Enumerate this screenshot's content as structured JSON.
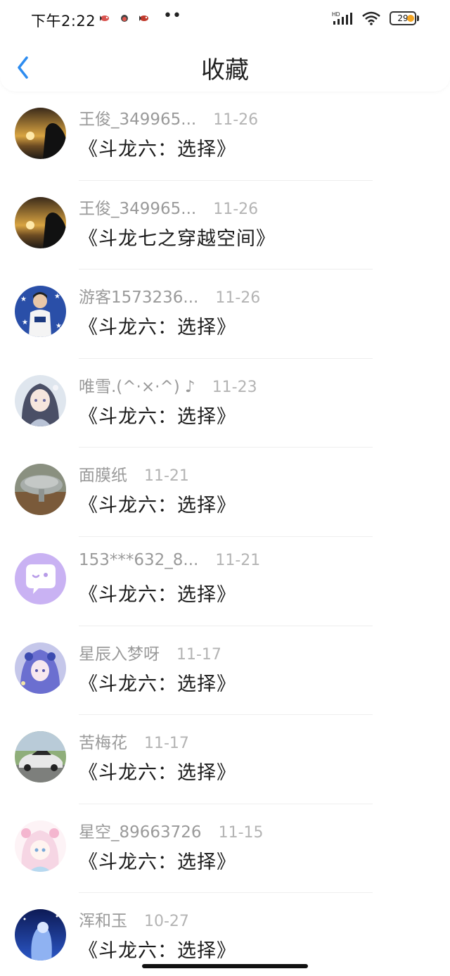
{
  "status_bar": {
    "time": "下午2:22",
    "more": "••",
    "network": "HD",
    "battery": "29",
    "colors": {
      "battery_charge": "#f5a623"
    }
  },
  "nav": {
    "title": "收藏",
    "back_icon": "chevron-left-icon",
    "accent": "#2d8cf0"
  },
  "items": [
    {
      "username": "王俊_349965...",
      "date": "11-26",
      "title": "《斗龙六：选择》",
      "avatar": "sunset-person"
    },
    {
      "username": "王俊_349965...",
      "date": "11-26",
      "title": "《斗龙七之穿越空间》",
      "avatar": "sunset-person"
    },
    {
      "username": "游客1573236...",
      "date": "11-26",
      "title": "《斗龙六：选择》",
      "avatar": "boy-blue-stars"
    },
    {
      "username": "唯雪.(^·×·^) ♪",
      "date": "11-23",
      "title": "《斗龙六：选择》",
      "avatar": "anime-girl"
    },
    {
      "username": "面膜纸",
      "date": "11-21",
      "title": "《斗龙六：选择》",
      "avatar": "stone-garden"
    },
    {
      "username": "153***632_8...",
      "date": "11-21",
      "title": "《斗龙六：选择》",
      "avatar": "default-purple"
    },
    {
      "username": "星辰入梦呀",
      "date": "11-17",
      "title": "《斗龙六：选择》",
      "avatar": "anime-purple"
    },
    {
      "username": "苦梅花",
      "date": "11-17",
      "title": "《斗龙六：选择》",
      "avatar": "sports-car"
    },
    {
      "username": "星空_89663726",
      "date": "11-15",
      "title": "《斗龙六：选择》",
      "avatar": "anime-pink"
    },
    {
      "username": "浑和玉",
      "date": "10-27",
      "title": "《斗龙六：选择》",
      "avatar": "night-blue"
    }
  ]
}
